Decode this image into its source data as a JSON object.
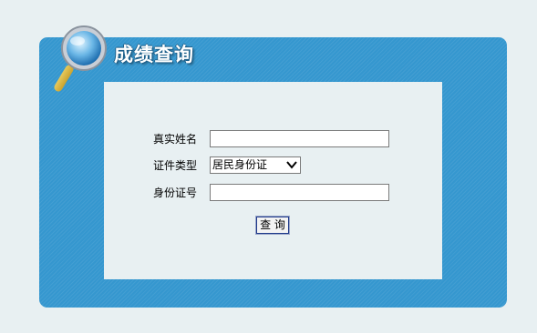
{
  "header": {
    "title": "成绩查询",
    "icon": "magnifier-icon"
  },
  "form": {
    "name_label": "真实姓名",
    "name_value": "",
    "id_type_label": "证件类型",
    "id_type_value": "居民身份证",
    "id_number_label": "身份证号",
    "id_number_value": "",
    "submit_label": "查 询"
  },
  "colors": {
    "panel": "#3597cf",
    "background": "#e8f0f2",
    "button_border": "#1f3a8a"
  }
}
